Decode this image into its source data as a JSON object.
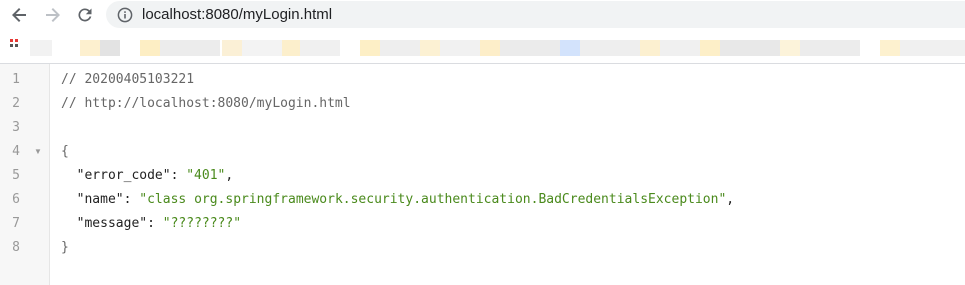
{
  "browser": {
    "url": "localhost:8080/myLogin.html",
    "colors": {
      "omnibox_bg": "#f1f3f4",
      "icon": "#5f6368"
    }
  },
  "code": {
    "lines": [
      {
        "number": "1",
        "comment": "// 20200405103221"
      },
      {
        "number": "2",
        "comment": "// http://localhost:8080/myLogin.html"
      },
      {
        "number": "3"
      },
      {
        "number": "4",
        "open_brace": "{"
      },
      {
        "number": "5",
        "key": "\"error_code\"",
        "colon": ": ",
        "value": "\"401\"",
        "comma": ","
      },
      {
        "number": "6",
        "key": "\"name\"",
        "colon": ": ",
        "value": "\"class org.springframework.security.authentication.BadCredentialsException\"",
        "comma": ","
      },
      {
        "number": "7",
        "key": "\"message\"",
        "colon": ": ",
        "value": "\"????????\""
      },
      {
        "number": "8",
        "close_brace": "}"
      }
    ],
    "colors": {
      "string": "#4a8a1c",
      "comment": "#666666",
      "line_number": "#999999"
    }
  }
}
